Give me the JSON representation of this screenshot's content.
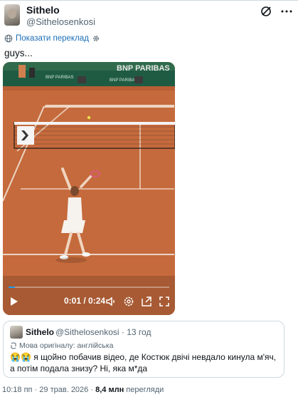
{
  "author": {
    "display_name": "Sithelo",
    "handle": "@Sithelosenkosi"
  },
  "translate": {
    "label": "Показати переклад"
  },
  "tweet": {
    "text": "guys..."
  },
  "video": {
    "time": "0:01 / 0:24",
    "progress": 0.04,
    "court_banner": "BNP PARIBAS",
    "colors": {
      "clay": "#c56a3c",
      "lines": "#f3e7dc",
      "banner": "#1f5b43"
    }
  },
  "quote": {
    "display_name": "Sithelo",
    "handle": "@Sithelosenkosi",
    "separator": "·",
    "time": "13 год",
    "original_language": "Мова оригіналу: англійська",
    "emoji": "😭😭",
    "text": "я щойно побачив відео, де Костюк двічі невдало кинула м'яч, а потім подала знизу? Ні, яка м*да"
  },
  "meta": {
    "time": "10:18 пп",
    "separator": "·",
    "date": "29 трав. 2026",
    "separator2": "·",
    "views": "8,4 млн",
    "views_label": "перегляди"
  }
}
